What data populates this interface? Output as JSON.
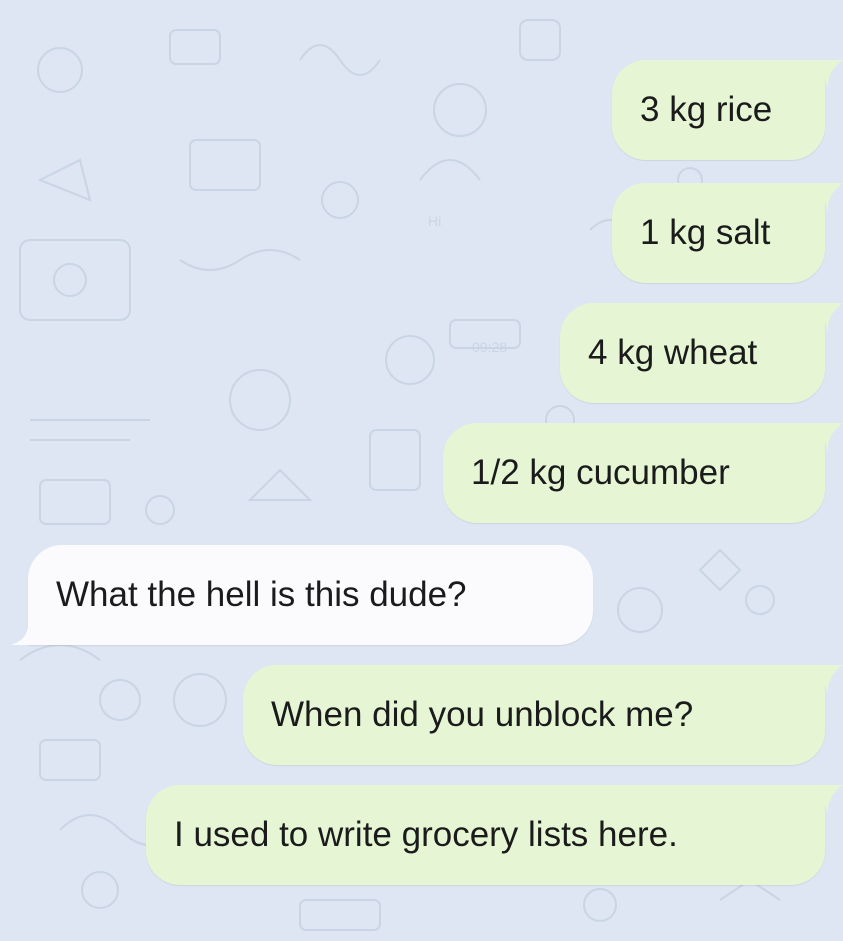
{
  "colors": {
    "background": "#dde6f2",
    "outgoing_bubble": "#e6f6d5",
    "incoming_bubble": "#fbfbfd",
    "text": "#1b1b1b"
  },
  "wallpaper": {
    "style": "doodle-pattern",
    "visible_text": [
      "09:28",
      "Hi"
    ]
  },
  "messages": [
    {
      "direction": "outgoing",
      "text": "3 kg rice"
    },
    {
      "direction": "outgoing",
      "text": "1 kg salt"
    },
    {
      "direction": "outgoing",
      "text": "4 kg wheat"
    },
    {
      "direction": "outgoing",
      "text": "1/2 kg cucumber"
    },
    {
      "direction": "incoming",
      "text": "What the hell is this dude?"
    },
    {
      "direction": "outgoing",
      "text": "When did you unblock me?"
    },
    {
      "direction": "outgoing",
      "text": "I used to write grocery lists here."
    }
  ]
}
